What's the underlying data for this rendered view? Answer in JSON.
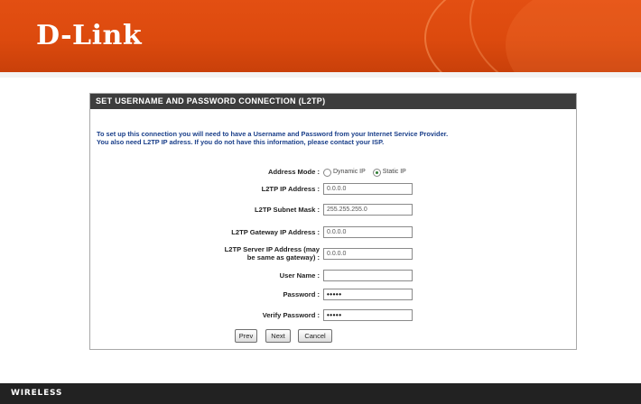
{
  "brand": {
    "logo": "D-Link"
  },
  "panel": {
    "title": "SET USERNAME AND PASSWORD CONNECTION (L2TP)",
    "intro_line1": "To set up this connection you will need to have a Username and Password from your Internet Service Provider.",
    "intro_line2": "You also need L2TP IP adress. If you do not have this information, please contact your ISP."
  },
  "form": {
    "address_mode": {
      "label": "Address Mode :",
      "options": [
        "Dynamic IP",
        "Static IP"
      ],
      "selected": "Static IP"
    },
    "l2tp_ip": {
      "label": "L2TP IP Address :",
      "value": "0.0.0.0"
    },
    "subnet": {
      "label": "L2TP Subnet Mask :",
      "value": "255.255.255.0"
    },
    "gateway": {
      "label": "L2TP Gateway IP Address :",
      "value": "0.0.0.0"
    },
    "server": {
      "label_line1": "L2TP Server IP Address (may",
      "label_line2": "be same as gateway) :",
      "value": "0.0.0.0"
    },
    "username": {
      "label": "User Name :",
      "value": ""
    },
    "password": {
      "label": "Password :",
      "value": "•••••"
    },
    "verify": {
      "label": "Verify Password :",
      "value": "•••••"
    }
  },
  "buttons": {
    "prev": "Prev",
    "next": "Next",
    "cancel": "Cancel"
  },
  "footer": {
    "label": "WIRELESS"
  }
}
